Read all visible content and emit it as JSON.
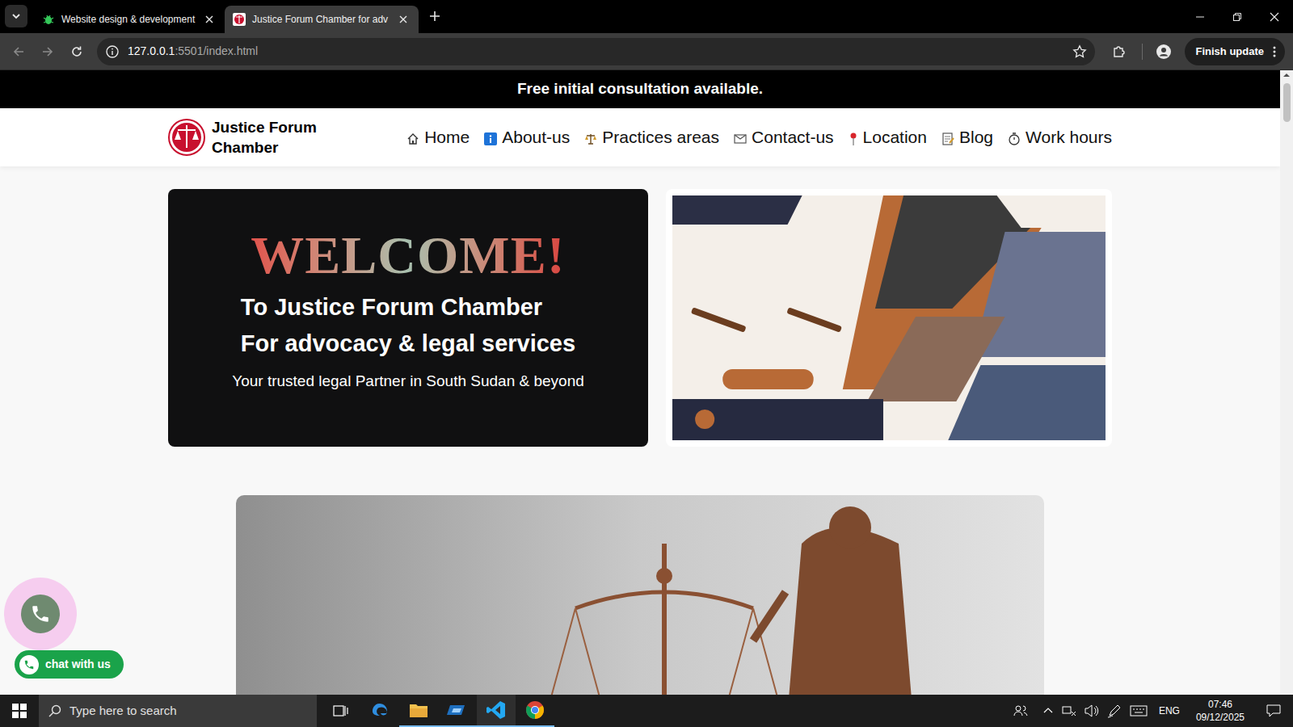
{
  "browser": {
    "tabs": [
      {
        "label": "Website design & development",
        "selected": false
      },
      {
        "label": "Justice Forum Chamber for adv",
        "selected": true
      }
    ],
    "url_host": "127.0.0.1",
    "url_rest": ":5501/index.html",
    "update_button": "Finish update"
  },
  "page": {
    "banner": "Free initial consultation available.",
    "brand": "Justice Forum Chamber",
    "nav": [
      "Home",
      "About-us",
      "Practices areas",
      "Contact-us",
      "Location",
      "Blog",
      "Work hours"
    ],
    "welcome": "WELCOME!",
    "lines": [
      "To Justice Forum Chamber",
      "For advocacy & legal services"
    ],
    "tagline": "Your trusted legal Partner in South Sudan & beyond",
    "chat_button": "chat with us"
  },
  "taskbar": {
    "search_placeholder": "Type here to search",
    "language": "ENG",
    "time": "07:46",
    "date": "09/12/2025"
  }
}
